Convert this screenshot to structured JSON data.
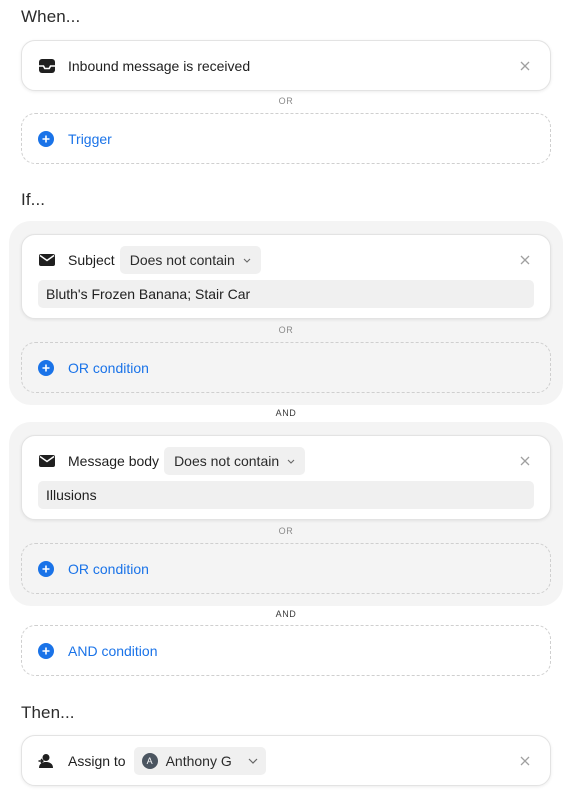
{
  "when": {
    "title": "When...",
    "trigger_card": {
      "label": "Inbound message is received",
      "icon": "inbox-icon"
    },
    "or_separator": "OR",
    "add_trigger_label": "Trigger"
  },
  "if": {
    "title": "If...",
    "groups": [
      {
        "field_label": "Subject",
        "operator": "Does not contain",
        "value": "Bluth's Frozen Banana; Stair Car",
        "or_separator": "OR",
        "add_or_label": "OR condition"
      },
      {
        "field_label": "Message body",
        "operator": "Does not contain",
        "value": "Illusions",
        "or_separator": "OR",
        "add_or_label": "OR condition"
      }
    ],
    "and_separator": "AND",
    "add_and_label": "AND condition"
  },
  "then": {
    "title": "Then...",
    "action_label": "Assign to",
    "assignee_initial": "A",
    "assignee_name": "Anthony G"
  },
  "colors": {
    "accent": "#1a73e8",
    "group_background": "#f4f4f4",
    "input_background": "#f0f0f0"
  }
}
